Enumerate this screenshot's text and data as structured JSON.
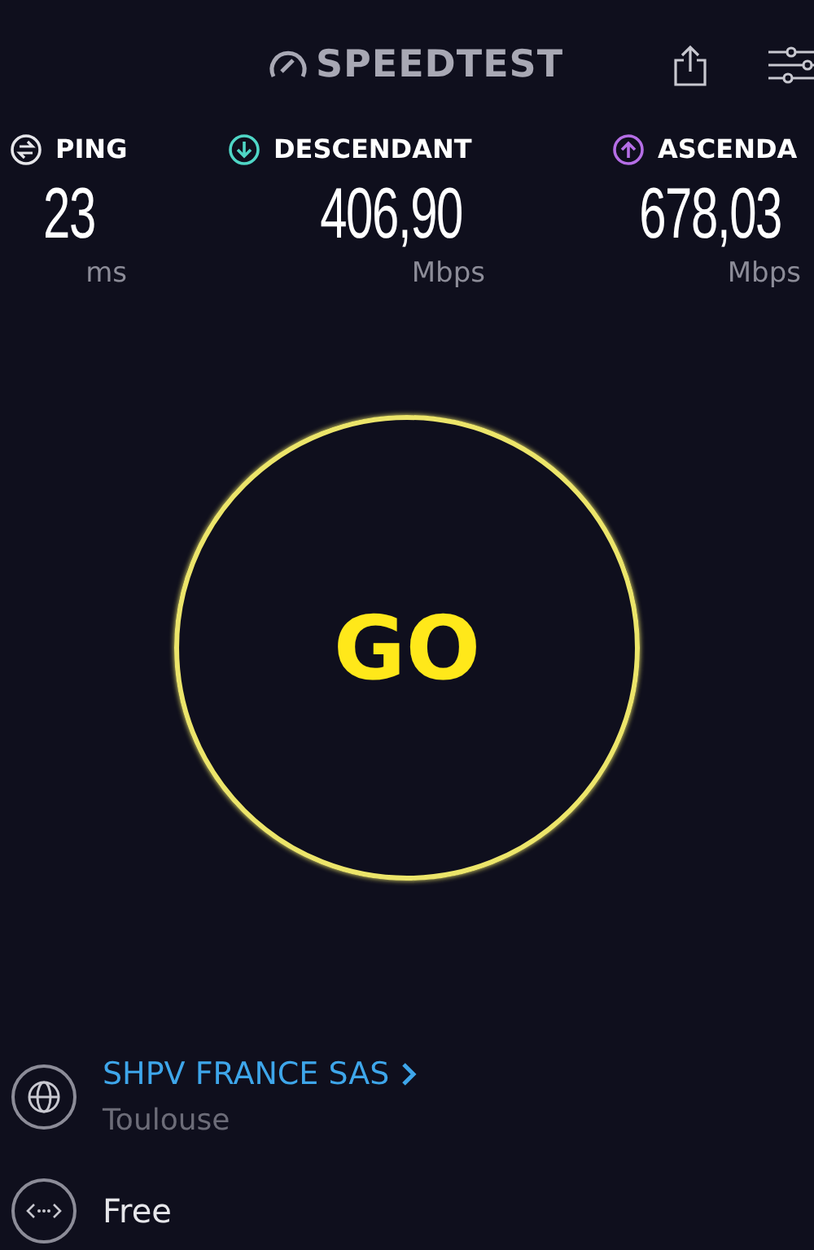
{
  "header": {
    "logo": "SPEEDTEST"
  },
  "metrics": [
    {
      "kind": "ping",
      "label": "PING",
      "value": "23",
      "unit": "ms",
      "color": "#e6e6ea"
    },
    {
      "kind": "download",
      "label": "DESCENDANT",
      "value": "406,90",
      "unit": "Mbps",
      "color": "#4fd6c6"
    },
    {
      "kind": "upload",
      "label": "ASCENDA",
      "value": "678,03",
      "unit": "Mbps",
      "color": "#b56ee6"
    }
  ],
  "go_button": {
    "label": "GO"
  },
  "server": {
    "name": "SHPV FRANCE SAS",
    "location": "Toulouse"
  },
  "provider": {
    "name": "Free"
  }
}
